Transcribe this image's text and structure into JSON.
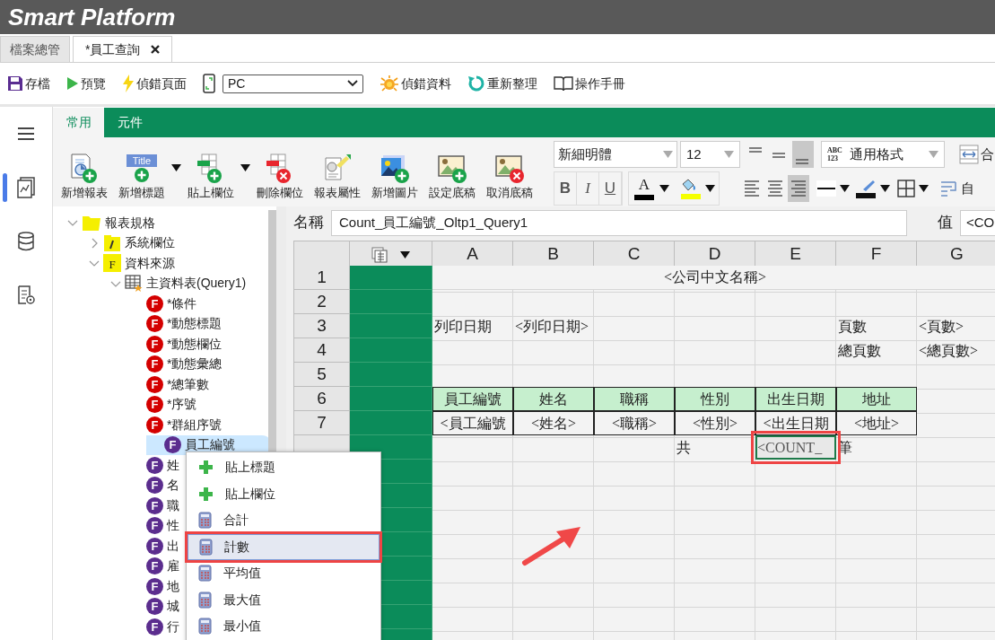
{
  "app_title": "Smart Platform",
  "doc_tabs": [
    {
      "label": "檔案總管",
      "selected": false,
      "closable": false
    },
    {
      "label": "*員工查詢",
      "selected": true,
      "closable": true
    }
  ],
  "toolbar": [
    {
      "kind": "button",
      "label": "存檔"
    },
    {
      "kind": "button",
      "label": "預覽"
    },
    {
      "kind": "button",
      "label": "偵錯頁面"
    },
    {
      "kind": "device-select",
      "value": "PC"
    },
    {
      "kind": "button",
      "label": "偵錯資料"
    },
    {
      "kind": "button",
      "label": "重新整理"
    },
    {
      "kind": "button",
      "label": "操作手冊"
    }
  ],
  "rail": [
    {
      "selected": false
    },
    {
      "selected": true
    },
    {
      "selected": false
    },
    {
      "selected": false
    }
  ],
  "ribbon": {
    "tabs": [
      {
        "label": "常用",
        "selected": true
      },
      {
        "label": "元件",
        "selected": false
      }
    ],
    "buttons": [
      {
        "label": "新增報表",
        "dropdown": false
      },
      {
        "label": "新增標題",
        "dropdown": true,
        "icon_text": "Title"
      },
      {
        "label": "貼上欄位",
        "dropdown": true
      },
      {
        "label": "刪除欄位",
        "dropdown": false
      },
      {
        "label": "報表屬性",
        "dropdown": false
      },
      {
        "label": "新增圖片",
        "dropdown": false
      },
      {
        "label": "設定底稿",
        "dropdown": false
      },
      {
        "label": "取消底稿",
        "dropdown": false
      }
    ],
    "font_family": "新細明體",
    "font_size": "12",
    "vertical_align": [
      {
        "selected": false
      },
      {
        "selected": false
      },
      {
        "selected": true
      }
    ],
    "number_format": {
      "badge": [
        "ABC",
        "123"
      ],
      "value": "通用格式"
    },
    "merge_label": "合",
    "text_styles": [
      {
        "label": "B",
        "on": false
      },
      {
        "label": "I",
        "on": false
      },
      {
        "label": "U",
        "on": false
      }
    ],
    "font_color_glyph": "A",
    "horizontal_align": [
      {
        "selected": false
      },
      {
        "selected": false
      },
      {
        "selected": true
      }
    ],
    "wrap_label": "自"
  },
  "tree": [
    {
      "label": "報表規格",
      "kind": "folder",
      "expanded": true,
      "children": [
        {
          "label": "系統欄位",
          "kind": "system",
          "expanded": false
        },
        {
          "label": "資料來源",
          "kind": "source",
          "badge": "F",
          "expanded": true,
          "children": [
            {
              "label": "主資料表(Query1)",
              "kind": "table",
              "expanded": true,
              "children": [
                {
                  "label": "*條件",
                  "kind": "field",
                  "badge": "F",
                  "color": "#d40000",
                  "selected": false
                },
                {
                  "label": "*動態標題",
                  "kind": "field",
                  "badge": "F",
                  "color": "#d40000",
                  "selected": false
                },
                {
                  "label": "*動態欄位",
                  "kind": "field",
                  "badge": "F",
                  "color": "#d40000",
                  "selected": false
                },
                {
                  "label": "*動態彙總",
                  "kind": "field",
                  "badge": "F",
                  "color": "#d40000",
                  "selected": false
                },
                {
                  "label": "*總筆數",
                  "kind": "field",
                  "badge": "F",
                  "color": "#d40000",
                  "selected": false
                },
                {
                  "label": "*序號",
                  "kind": "field",
                  "badge": "F",
                  "color": "#d40000",
                  "selected": false
                },
                {
                  "label": "*群組序號",
                  "kind": "field",
                  "badge": "F",
                  "color": "#d40000",
                  "selected": false
                },
                {
                  "label": "員工編號",
                  "kind": "field",
                  "badge": "F",
                  "color": "#5b2d8e",
                  "selected": true
                },
                {
                  "label": "姓",
                  "kind": "field",
                  "badge": "F",
                  "color": "#5b2d8e",
                  "selected": false
                },
                {
                  "label": "名",
                  "kind": "field",
                  "badge": "F",
                  "color": "#5b2d8e",
                  "selected": false
                },
                {
                  "label": "職",
                  "kind": "field",
                  "badge": "F",
                  "color": "#5b2d8e",
                  "selected": false
                },
                {
                  "label": "性",
                  "kind": "field",
                  "badge": "F",
                  "color": "#5b2d8e",
                  "selected": false
                },
                {
                  "label": "出",
                  "kind": "field",
                  "badge": "F",
                  "color": "#5b2d8e",
                  "selected": false
                },
                {
                  "label": "雇",
                  "kind": "field",
                  "badge": "F",
                  "color": "#5b2d8e",
                  "selected": false
                },
                {
                  "label": "地",
                  "kind": "field",
                  "badge": "F",
                  "color": "#5b2d8e",
                  "selected": false
                },
                {
                  "label": "城",
                  "kind": "field",
                  "badge": "F",
                  "color": "#5b2d8e",
                  "selected": false
                },
                {
                  "label": "行",
                  "kind": "field",
                  "badge": "F",
                  "color": "#5b2d8e",
                  "selected": false
                }
              ]
            }
          ]
        }
      ]
    }
  ],
  "name_field": {
    "label": "名稱",
    "value": "Count_員工編號_Oltp1_Query1"
  },
  "value_field": {
    "label": "值",
    "value": "<CO"
  },
  "sheet": {
    "columns": [
      "A",
      "B",
      "C",
      "D",
      "E",
      "F",
      "G"
    ],
    "rows": [
      {
        "number": "1",
        "cells": [
          {
            "kind": "title",
            "text": "<公司中文名稱>",
            "selected": false
          }
        ]
      },
      {
        "number": "2"
      },
      {
        "number": "3",
        "cells": [
          {
            "kind": "plain",
            "text": "列印日期",
            "selected": false
          },
          {
            "kind": "plain",
            "text": "<列印日期>",
            "selected": false
          },
          {
            "kind": "empty"
          },
          {
            "kind": "empty"
          },
          {
            "kind": "empty"
          },
          {
            "kind": "plain",
            "text": "頁數",
            "selected": false
          },
          {
            "kind": "plain",
            "text": "<頁數>",
            "selected": false
          }
        ]
      },
      {
        "number": "4",
        "cells": [
          {
            "kind": "empty"
          },
          {
            "kind": "empty"
          },
          {
            "kind": "empty"
          },
          {
            "kind": "empty"
          },
          {
            "kind": "empty"
          },
          {
            "kind": "plain",
            "text": "總頁數",
            "selected": false
          },
          {
            "kind": "plain",
            "text": "<總頁數>",
            "selected": false
          }
        ]
      },
      {
        "number": "5"
      },
      {
        "number": "6",
        "cells": [
          {
            "kind": "header",
            "text": "員工編號",
            "selected": false
          },
          {
            "kind": "header",
            "text": "姓名",
            "selected": false
          },
          {
            "kind": "header",
            "text": "職稱",
            "selected": false
          },
          {
            "kind": "header",
            "text": "性別",
            "selected": false
          },
          {
            "kind": "header",
            "text": "出生日期",
            "selected": false
          },
          {
            "kind": "header",
            "text": "地址",
            "selected": false
          }
        ]
      },
      {
        "number": "7",
        "cells": [
          {
            "kind": "data",
            "text": "<員工編號",
            "selected": false
          },
          {
            "kind": "data",
            "text": "<姓名>",
            "selected": false
          },
          {
            "kind": "data",
            "text": "<職稱>",
            "selected": false
          },
          {
            "kind": "data",
            "text": "<性別>",
            "selected": false
          },
          {
            "kind": "data",
            "text": "<出生日期",
            "selected": false
          },
          {
            "kind": "data",
            "text": "<地址>",
            "selected": false
          }
        ]
      },
      {
        "cells": [
          {
            "kind": "empty"
          },
          {
            "kind": "empty"
          },
          {
            "kind": "empty"
          },
          {
            "kind": "plain",
            "text": "共",
            "selected": false
          },
          {
            "kind": "plain",
            "text": "<COUNT_",
            "selected": true
          },
          {
            "kind": "plain",
            "text": "筆",
            "selected": false
          }
        ]
      }
    ]
  },
  "context_menu": [
    {
      "label": "貼上標題",
      "kind": "paste",
      "selected": false
    },
    {
      "label": "貼上欄位",
      "kind": "paste",
      "selected": false
    },
    {
      "label": "合計",
      "kind": "aggregate",
      "selected": false
    },
    {
      "label": "計數",
      "kind": "aggregate",
      "selected": true
    },
    {
      "label": "平均值",
      "kind": "aggregate",
      "selected": false
    },
    {
      "label": "最大值",
      "kind": "aggregate",
      "selected": false
    },
    {
      "label": "最小值",
      "kind": "aggregate",
      "selected": false
    }
  ]
}
